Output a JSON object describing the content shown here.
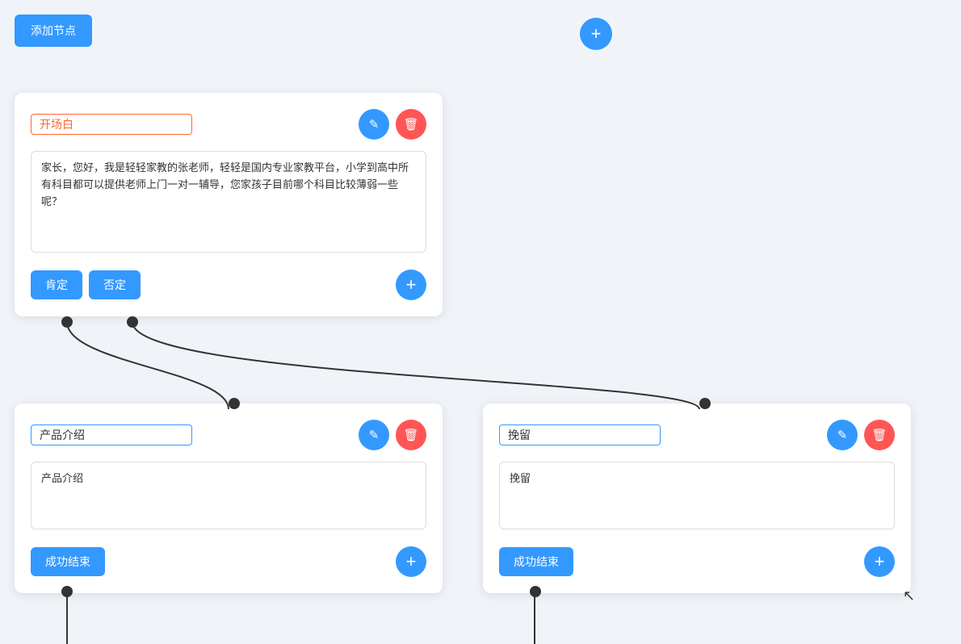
{
  "toolbar": {
    "add_node_label": "添加节点"
  },
  "float_plus": "+",
  "node1": {
    "title": "开场白",
    "title_placeholder": "开场白",
    "textarea_content": "家长，您好，我是轻轻家教的张老师，轻轻是国内专业家教平台，小学到高中所有科目都可以提供老师上门一对一辅导，您家孩子目前哪个科目比较薄弱一些呢？",
    "btn_yes": "肯定",
    "btn_no": "否定",
    "edit_icon": "✎",
    "delete_icon": "🗑",
    "plus_icon": "+"
  },
  "node2": {
    "title": "产品介绍",
    "title_placeholder": "产品介绍",
    "textarea_content": "产品介绍",
    "btn_end": "成功结束",
    "edit_icon": "✎",
    "delete_icon": "🗑",
    "plus_icon": "+"
  },
  "node3": {
    "title": "挽留",
    "title_placeholder": "挽留",
    "textarea_content": "挽留",
    "btn_end": "成功结束",
    "edit_icon": "✎",
    "delete_icon": "🗑",
    "plus_icon": "+"
  },
  "colors": {
    "blue": "#3399ff",
    "red": "#ff5555",
    "orange": "#ff6633"
  }
}
